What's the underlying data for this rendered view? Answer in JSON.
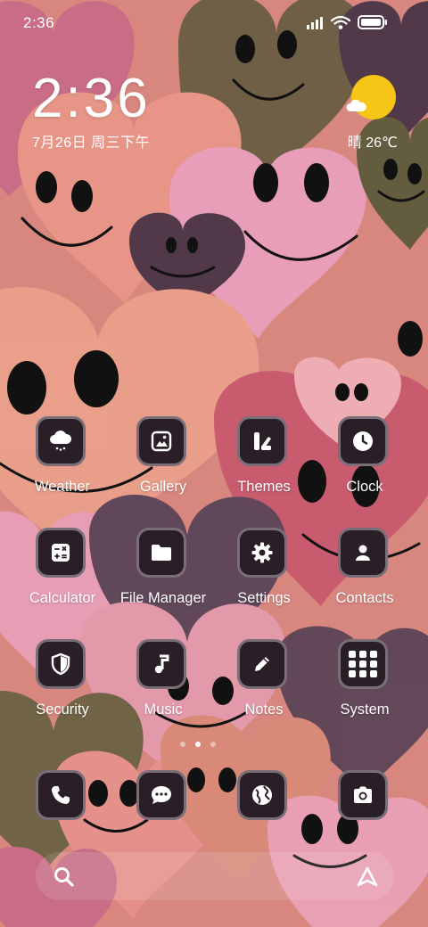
{
  "status_bar": {
    "time": "2:36"
  },
  "clock_widget": {
    "time": "2:36",
    "date": "7月26日 周三下午"
  },
  "weather_widget": {
    "text": "晴 26℃",
    "icon": "sun-cloud-icon",
    "sun_color": "#f5c518"
  },
  "apps": [
    {
      "label": "Weather",
      "icon": "weather-cloud-icon"
    },
    {
      "label": "Gallery",
      "icon": "gallery-icon"
    },
    {
      "label": "Themes",
      "icon": "themes-icon"
    },
    {
      "label": "Clock",
      "icon": "clock-icon"
    },
    {
      "label": "Calculator",
      "icon": "calculator-icon"
    },
    {
      "label": "File Manager",
      "icon": "folder-icon"
    },
    {
      "label": "Settings",
      "icon": "gear-icon"
    },
    {
      "label": "Contacts",
      "icon": "contact-icon"
    },
    {
      "label": "Security",
      "icon": "shield-icon"
    },
    {
      "label": "Music",
      "icon": "music-note-icon"
    },
    {
      "label": "Notes",
      "icon": "pencil-icon"
    },
    {
      "label": "System",
      "icon": "folder-grid-icon"
    }
  ],
  "page_indicator": {
    "pages": 3,
    "active": 2
  },
  "dock": [
    {
      "icon": "phone-icon"
    },
    {
      "icon": "message-icon"
    },
    {
      "icon": "browser-globe-icon"
    },
    {
      "icon": "camera-icon"
    }
  ],
  "search_bar": {
    "left_icon": "search-icon",
    "right_icon": "assistant-icon"
  },
  "colors": {
    "icon_bg": "#2a1f26",
    "icon_border": "#7a6f78",
    "text": "#ffffff"
  }
}
